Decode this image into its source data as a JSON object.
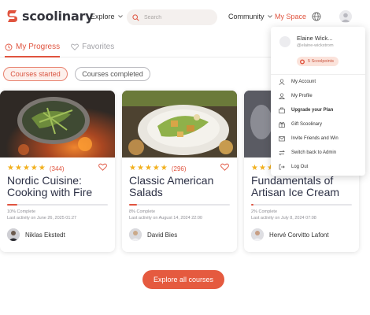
{
  "header": {
    "logo_text": "scoolinary",
    "nav_explore": "Explore",
    "search_placeholder": "Search",
    "nav_community": "Community",
    "nav_myspace": "My Space",
    "brand_color": "#e0543f"
  },
  "tabs": [
    {
      "label": "My Progress",
      "active": true,
      "icon": "progress-icon"
    },
    {
      "label": "Favorites",
      "active": false,
      "icon": "heart-icon"
    }
  ],
  "filters": [
    {
      "label": "Courses started",
      "active": true
    },
    {
      "label": "Courses completed",
      "active": false
    }
  ],
  "courses": [
    {
      "title": "Nordic Cuisine: Cooking with Fire",
      "rating_count": "(344)",
      "stars": 5,
      "progress": 10,
      "complete_text": "10% Complete",
      "activity_text": "Last activity on June 26, 2025 01:27",
      "author": "Niklas Ekstedt"
    },
    {
      "title": "Classic American Salads",
      "rating_count": "(296)",
      "stars": 5,
      "progress": 8,
      "complete_text": "8% Complete",
      "activity_text": "Last activity on August 14, 2024 22:00",
      "author": "David Bies"
    },
    {
      "title": "Fundamentals of Artisan Ice Cream",
      "rating_count": "",
      "stars": 5,
      "progress": 2,
      "complete_text": "2% Complete",
      "activity_text": "Last activity on July 8, 2024 07:08",
      "author": "Hervé Corvitto Lafont"
    }
  ],
  "explore_button": "Explore all courses",
  "dropdown": {
    "name": "Elaine Wick...",
    "handle": "@elaine-wickstrom",
    "points": "5 Scoolpoints",
    "items": [
      {
        "label": "My Account",
        "icon": "account-icon",
        "bold": false
      },
      {
        "label": "My Profile",
        "icon": "profile-icon",
        "bold": false
      },
      {
        "label": "Upgrade your Plan",
        "icon": "upgrade-icon",
        "bold": true
      },
      {
        "label": "Gift Scoolinary",
        "icon": "gift-icon",
        "bold": false
      },
      {
        "label": "Invite Friends and Win",
        "icon": "invite-icon",
        "bold": false
      },
      {
        "label": "Switch back to Admin",
        "icon": "switch-icon",
        "bold": false
      },
      {
        "label": "Log Out",
        "icon": "logout-icon",
        "bold": false
      }
    ]
  }
}
